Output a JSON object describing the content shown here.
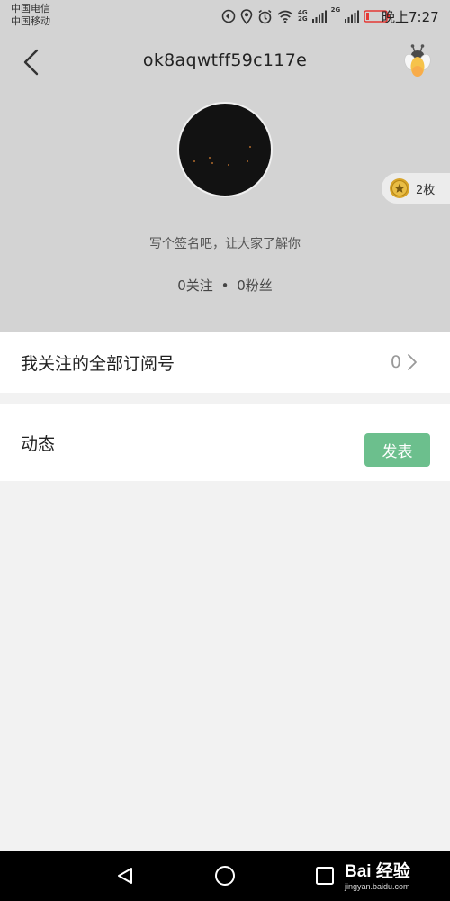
{
  "status_bar": {
    "carrier_1": "中国电信",
    "carrier_2": "中国移动",
    "network_tag_top": "4G",
    "network_tag_bottom": "2G",
    "network_tag_2": "2G",
    "time": "晚上7:27",
    "battery_color": "#e53935"
  },
  "header": {
    "nickname": "ok8aqwtff59c117e",
    "background_color": "#d3d3d3",
    "back_icon": "chevron-left-icon",
    "firefly_icon": "firefly-icon",
    "coins": {
      "count_label": "2枚",
      "icon": "coin-star-icon"
    }
  },
  "profile": {
    "signature_placeholder": "写个签名吧，让大家了解你",
    "following_label": "0关注",
    "separator": "•",
    "followers_label": "0粉丝"
  },
  "subscriptions_row": {
    "label": "我关注的全部订阅号",
    "count": "0"
  },
  "feed_row": {
    "label": "动态",
    "publish_label": "发表",
    "accent_color": "#6cbf8d"
  },
  "navbar": {
    "buttons": [
      "back-triangle-icon",
      "home-circle-icon",
      "recent-square-icon"
    ],
    "watermark": {
      "brand": "Bai 经验",
      "url": "jingyan.baidu.com"
    }
  }
}
